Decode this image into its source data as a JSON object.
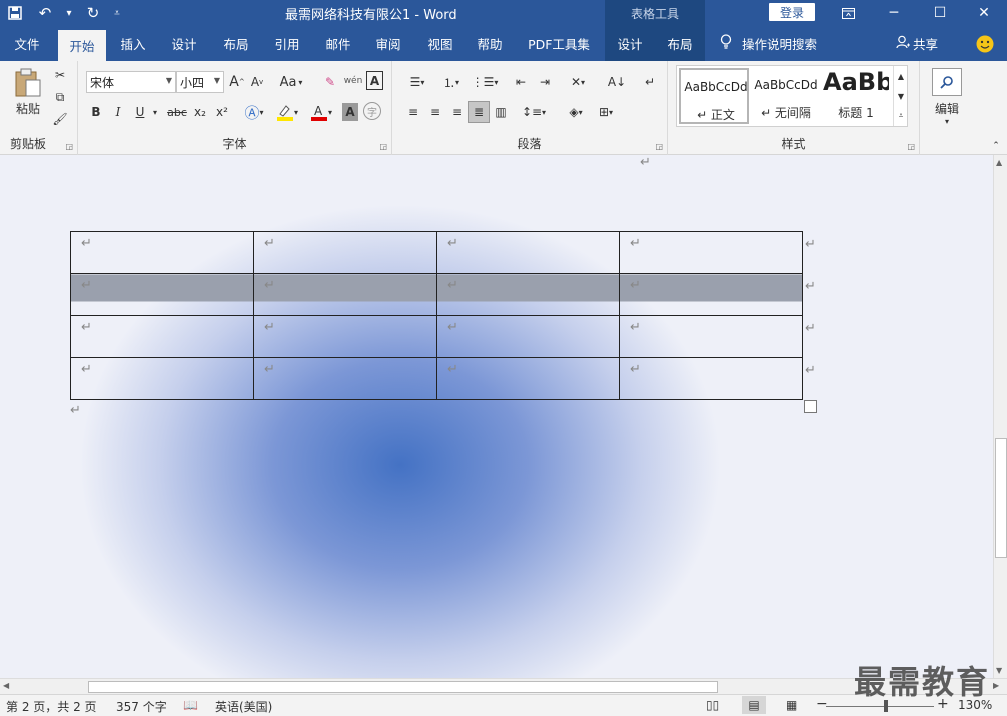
{
  "titlebar": {
    "doc_title": "最需网络科技有限公1  -  Word",
    "context_header": "表格工具",
    "login": "登录",
    "save_icon": "floppy-icon",
    "undo_icon": "undo-icon",
    "redo_icon": "redo-icon",
    "customize_icon": "customize-qat-icon"
  },
  "tabs": {
    "file": "文件",
    "home": "开始",
    "insert": "插入",
    "design": "设计",
    "layout": "布局",
    "references": "引用",
    "mailings": "邮件",
    "review": "审阅",
    "view": "视图",
    "help": "帮助",
    "pdf": "PDF工具集",
    "table_design": "设计",
    "table_layout": "布局",
    "tell_me": "操作说明搜索",
    "share": "共享"
  },
  "ribbon": {
    "clipboard": {
      "paste": "粘贴",
      "label": "剪贴板"
    },
    "font": {
      "name": "宋体",
      "size": "小四",
      "label": "字体",
      "bold": "B",
      "italic": "I",
      "underline": "U",
      "strike": "abc",
      "sub": "x₂",
      "sup": "x²",
      "grow": "A",
      "shrink": "A",
      "case": "Aa",
      "wen": "wén",
      "border_char": "A"
    },
    "paragraph": {
      "label": "段落"
    },
    "styles": {
      "label": "样式",
      "items": [
        {
          "preview": "AaBbCcDd",
          "name": "↵ 正文"
        },
        {
          "preview": "AaBbCcDd",
          "name": "↵ 无间隔"
        },
        {
          "preview": "AaBb",
          "name": "标题 1"
        }
      ]
    },
    "editing": {
      "label": "编辑"
    }
  },
  "document": {
    "mark": "↵",
    "rows": 4,
    "cols": 4,
    "selected_row": 2
  },
  "status": {
    "page": "第 2 页，共 2 页",
    "words": "357 个字",
    "language": "英语(美国)",
    "zoom": "130%",
    "zoom_minus": "−",
    "zoom_plus": "+"
  },
  "watermark": "最需教育",
  "colors": {
    "accent": "#2b579a",
    "context": "#1e4880",
    "canvas_center": "#4472c4",
    "selection": "#9aa0ad"
  }
}
